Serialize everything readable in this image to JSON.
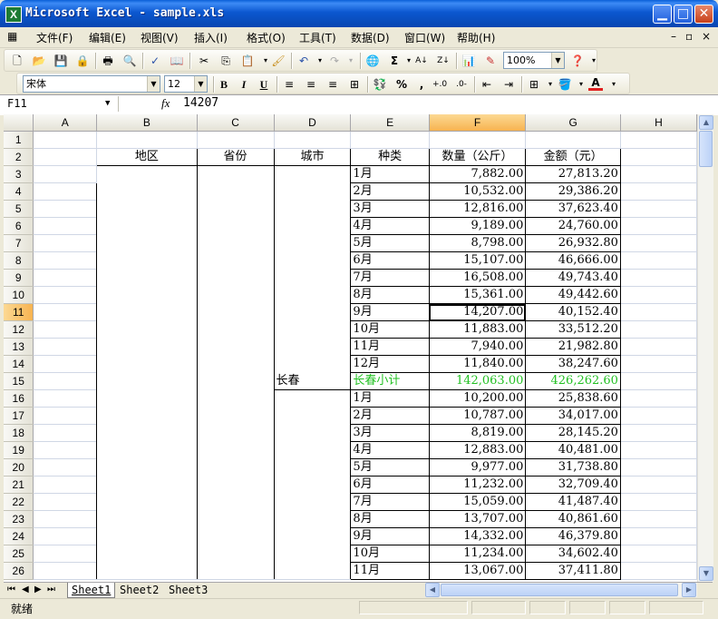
{
  "window": {
    "title": "Microsoft Excel - sample.xls",
    "app_icon": "X"
  },
  "menu": {
    "items": [
      "文件(F)",
      "编辑(E)",
      "视图(V)",
      "插入(I)",
      "格式(O)",
      "工具(T)",
      "数据(D)",
      "窗口(W)",
      "帮助(H)"
    ],
    "doc_controls": [
      "–",
      "▫",
      "×"
    ]
  },
  "toolbar": {
    "zoom": "100%",
    "font_name": "宋体",
    "font_size": "12",
    "bold": "B",
    "italic": "I",
    "underline": "U",
    "percent": "%",
    "comma": ","
  },
  "formula": {
    "name_box": "F11",
    "fx": "fx",
    "value": "14207"
  },
  "columns": [
    "A",
    "B",
    "C",
    "D",
    "E",
    "F",
    "G",
    "H"
  ],
  "selected_column": "F",
  "selected_row": 11,
  "headers": {
    "region": "地区",
    "province": "省份",
    "city": "城市",
    "type": "种类",
    "qty": "数量（公斤）",
    "amount": "金额（元）"
  },
  "city_label": "长春",
  "rows": [
    {
      "row": "1",
      "type": "",
      "qty": "",
      "amount": ""
    },
    {
      "row": "2",
      "type": "",
      "qty": "",
      "amount": ""
    },
    {
      "row": "3",
      "type": "1月",
      "qty": "7,882.00",
      "amount": "27,813.20"
    },
    {
      "row": "4",
      "type": "2月",
      "qty": "10,532.00",
      "amount": "29,386.20"
    },
    {
      "row": "5",
      "type": "3月",
      "qty": "12,816.00",
      "amount": "37,623.40"
    },
    {
      "row": "6",
      "type": "4月",
      "qty": "9,189.00",
      "amount": "24,760.00"
    },
    {
      "row": "7",
      "type": "5月",
      "qty": "8,798.00",
      "amount": "26,932.80"
    },
    {
      "row": "8",
      "type": "6月",
      "qty": "15,107.00",
      "amount": "46,666.00"
    },
    {
      "row": "9",
      "type": "7月",
      "qty": "16,508.00",
      "amount": "49,743.40"
    },
    {
      "row": "10",
      "type": "8月",
      "qty": "15,361.00",
      "amount": "49,442.60"
    },
    {
      "row": "11",
      "type": "9月",
      "qty": "14,207.00",
      "amount": "40,152.40"
    },
    {
      "row": "12",
      "type": "10月",
      "qty": "11,883.00",
      "amount": "33,512.20"
    },
    {
      "row": "13",
      "type": "11月",
      "qty": "7,940.00",
      "amount": "21,982.80"
    },
    {
      "row": "14",
      "type": "12月",
      "qty": "11,840.00",
      "amount": "38,247.60"
    },
    {
      "row": "15",
      "type": "长春小计",
      "qty": "142,063.00",
      "amount": "426,262.60"
    },
    {
      "row": "16",
      "type": "1月",
      "qty": "10,200.00",
      "amount": "25,838.60"
    },
    {
      "row": "17",
      "type": "2月",
      "qty": "10,787.00",
      "amount": "34,017.00"
    },
    {
      "row": "18",
      "type": "3月",
      "qty": "8,819.00",
      "amount": "28,145.20"
    },
    {
      "row": "19",
      "type": "4月",
      "qty": "12,883.00",
      "amount": "40,481.00"
    },
    {
      "row": "20",
      "type": "5月",
      "qty": "9,977.00",
      "amount": "31,738.80"
    },
    {
      "row": "21",
      "type": "6月",
      "qty": "11,232.00",
      "amount": "32,709.40"
    },
    {
      "row": "22",
      "type": "7月",
      "qty": "15,059.00",
      "amount": "41,487.40"
    },
    {
      "row": "23",
      "type": "8月",
      "qty": "13,707.00",
      "amount": "40,861.60"
    },
    {
      "row": "24",
      "type": "9月",
      "qty": "14,332.00",
      "amount": "46,379.80"
    },
    {
      "row": "25",
      "type": "10月",
      "qty": "11,234.00",
      "amount": "34,602.40"
    },
    {
      "row": "26",
      "type": "11月",
      "qty": "13,067.00",
      "amount": "37,411.80"
    }
  ],
  "subtotal_color": "#22c022",
  "sheets": [
    "Sheet1",
    "Sheet2",
    "Sheet3"
  ],
  "status": {
    "text": "就绪"
  }
}
